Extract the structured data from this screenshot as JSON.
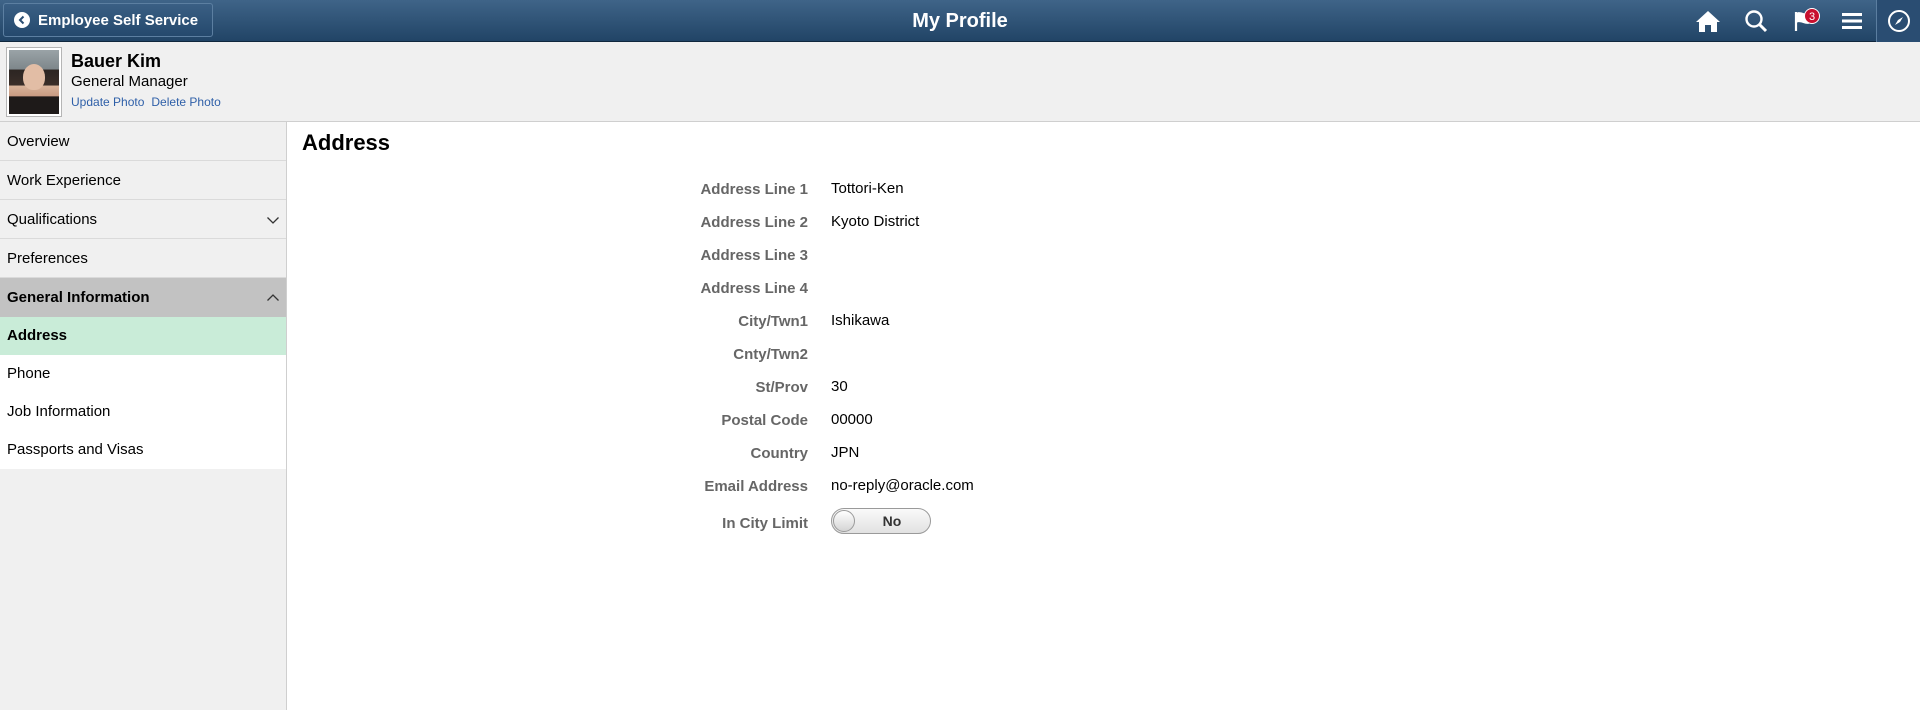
{
  "banner": {
    "back_label": "Employee Self Service",
    "title": "My Profile",
    "notifications_count": "3",
    "icons": [
      "home-icon",
      "search-icon",
      "notifications-flag-icon",
      "actions-menu-icon",
      "navbar-compass-icon"
    ]
  },
  "profile": {
    "name": "Bauer Kim",
    "job_title": "General Manager",
    "update_photo": "Update Photo",
    "delete_photo": "Delete Photo"
  },
  "sidebar": {
    "items": [
      {
        "label": "Overview"
      },
      {
        "label": "Work Experience"
      },
      {
        "label": "Qualifications",
        "icon": "chevron-down-icon"
      },
      {
        "label": "Preferences"
      }
    ],
    "group": {
      "label": "General Information",
      "icon": "chevron-up-icon"
    },
    "sub_items": [
      {
        "label": "Address",
        "active": true
      },
      {
        "label": "Phone"
      },
      {
        "label": "Job Information"
      },
      {
        "label": "Passports and Visas"
      }
    ]
  },
  "main": {
    "title": "Address",
    "fields": [
      {
        "label": "Address Line 1",
        "value": "Tottori-Ken"
      },
      {
        "label": "Address Line 2",
        "value": "Kyoto District"
      },
      {
        "label": "Address Line 3",
        "value": ""
      },
      {
        "label": "Address Line 4",
        "value": ""
      },
      {
        "label": "City/Twn1",
        "value": "Ishikawa"
      },
      {
        "label": "Cnty/Twn2",
        "value": ""
      },
      {
        "label": "St/Prov",
        "value": "30"
      },
      {
        "label": "Postal Code",
        "value": "00000"
      },
      {
        "label": "Country",
        "value": "JPN"
      },
      {
        "label": "Email Address",
        "value": "no-reply@oracle.com"
      }
    ],
    "in_city_limit": {
      "label": "In City Limit",
      "value": "No"
    }
  },
  "colors": {
    "banner": "#2e5378",
    "active_nav": "#c9ecd8",
    "group_nav": "#c2c2c2",
    "link": "#2e5fa8"
  }
}
